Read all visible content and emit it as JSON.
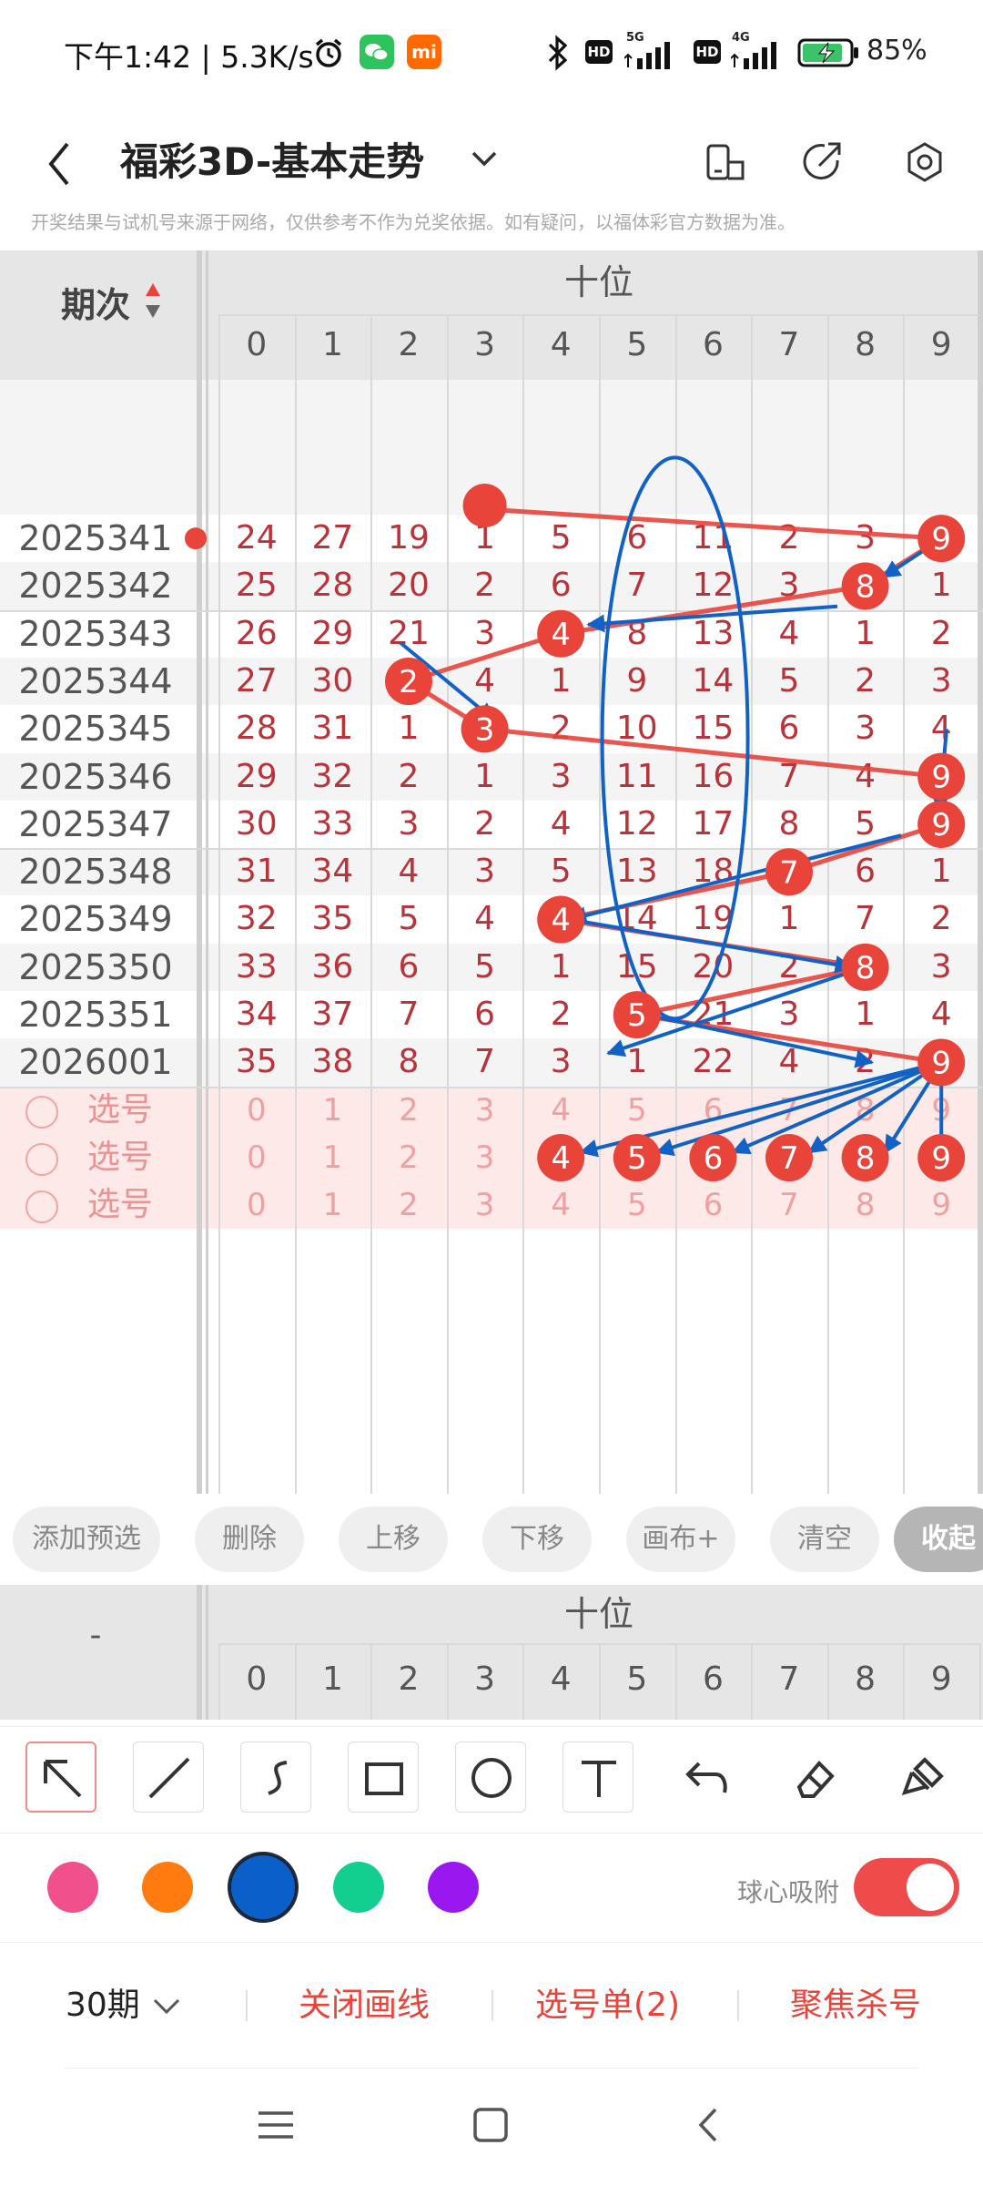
{
  "status": {
    "time": "下午1:42 | 5.3K/s",
    "icons": [
      "alarm-icon",
      "wechat-icon",
      "mi-icon"
    ],
    "right_icons": [
      "bluetooth-icon",
      "hd-signal-icon",
      "5g-signal-icon",
      "hd-signal-icon",
      "4g-signal-icon",
      "battery-icon"
    ],
    "net5g": "5G",
    "net4g": "4G",
    "hd": "HD",
    "mi": "mi",
    "battery": "85%",
    "battery_level": 0.85
  },
  "header": {
    "title": "福彩3D-基本走势",
    "icons": [
      "back-icon",
      "chevron-down-icon",
      "layout-icon",
      "share-icon",
      "settings-icon"
    ]
  },
  "notice": "开奖结果与试机号来源于网络，仅供参考不作为兑奖依据。如有疑问，以福体彩官方数据为准。",
  "grid": {
    "period_header": "期次",
    "section_header": "十位",
    "digit_headers": [
      "0",
      "1",
      "2",
      "3",
      "4",
      "5",
      "6",
      "7",
      "8",
      "9"
    ],
    "rows": [
      {
        "period": "2025341",
        "cells": [
          "24",
          "27",
          "19",
          "1",
          "5",
          "6",
          "11",
          "2",
          "3",
          "9"
        ],
        "hit": 9
      },
      {
        "period": "2025342",
        "cells": [
          "25",
          "28",
          "20",
          "2",
          "6",
          "7",
          "12",
          "3",
          "8",
          "1"
        ],
        "hit": 8
      },
      {
        "period": "2025343",
        "cells": [
          "26",
          "29",
          "21",
          "3",
          "4",
          "8",
          "13",
          "4",
          "1",
          "2"
        ],
        "hit": 4
      },
      {
        "period": "2025344",
        "cells": [
          "27",
          "30",
          "2",
          "4",
          "1",
          "9",
          "14",
          "5",
          "2",
          "3"
        ],
        "hit": 2
      },
      {
        "period": "2025345",
        "cells": [
          "28",
          "31",
          "1",
          "3",
          "2",
          "10",
          "15",
          "6",
          "3",
          "4"
        ],
        "hit": 3
      },
      {
        "period": "2025346",
        "cells": [
          "29",
          "32",
          "2",
          "1",
          "3",
          "11",
          "16",
          "7",
          "4",
          "9"
        ],
        "hit": 9
      },
      {
        "period": "2025347",
        "cells": [
          "30",
          "33",
          "3",
          "2",
          "4",
          "12",
          "17",
          "8",
          "5",
          "9"
        ],
        "hit": 9
      },
      {
        "period": "2025348",
        "cells": [
          "31",
          "34",
          "4",
          "3",
          "5",
          "13",
          "18",
          "7",
          "6",
          "1"
        ],
        "hit": 7
      },
      {
        "period": "2025349",
        "cells": [
          "32",
          "35",
          "5",
          "4",
          "4",
          "14",
          "19",
          "1",
          "7",
          "2"
        ],
        "hit": 4
      },
      {
        "period": "2025350",
        "cells": [
          "33",
          "36",
          "6",
          "5",
          "1",
          "15",
          "20",
          "2",
          "8",
          "3"
        ],
        "hit": 8
      },
      {
        "period": "2025351",
        "cells": [
          "34",
          "37",
          "7",
          "6",
          "2",
          "5",
          "21",
          "3",
          "1",
          "4"
        ],
        "hit": 5
      },
      {
        "period": "2026001",
        "cells": [
          "35",
          "38",
          "8",
          "7",
          "3",
          "1",
          "22",
          "4",
          "2",
          "9"
        ],
        "hit": 9
      }
    ],
    "pick_label": "选号",
    "pick_rows": [
      {
        "label": "选号",
        "cells": [
          "0",
          "1",
          "2",
          "3",
          "4",
          "5",
          "6",
          "7",
          "8",
          "9"
        ],
        "selected": []
      },
      {
        "label": "选号",
        "cells": [
          "0",
          "1",
          "2",
          "3",
          "4",
          "5",
          "6",
          "7",
          "8",
          "9"
        ],
        "selected": [
          4,
          5,
          6,
          7,
          8,
          9
        ]
      },
      {
        "label": "选号",
        "cells": [
          "0",
          "1",
          "2",
          "3",
          "4",
          "5",
          "6",
          "7",
          "8",
          "9"
        ],
        "selected": []
      }
    ]
  },
  "actions": [
    "添加预选",
    "删除",
    "上移",
    "下移",
    "画布+",
    "清空",
    "收起"
  ],
  "header2": {
    "period_header": "-",
    "section_header": "十位",
    "digit_headers": [
      "0",
      "1",
      "2",
      "3",
      "4",
      "5",
      "6",
      "7",
      "8",
      "9"
    ]
  },
  "tools": [
    "arrow-tool-icon",
    "line-tool-icon",
    "curve-tool-icon",
    "rectangle-tool-icon",
    "circle-tool-icon",
    "text-tool-icon",
    "undo-icon",
    "eraser-icon",
    "clear-brush-icon"
  ],
  "colors": {
    "swatches": [
      "#f0508c",
      "#ff7a0f",
      "#0a5fc8",
      "#13cf8f",
      "#9b17f0"
    ],
    "selected": "#0a5fc8",
    "red": "#e8443a",
    "blue": "#1262c6"
  },
  "snap_label": "球心吸附",
  "snap_on": true,
  "bottom": {
    "periods": "30期",
    "close_lines": "关闭画线",
    "pick_list": "选号单(2)",
    "focus_kill": "聚焦杀号"
  },
  "nav_icons": [
    "menu-icon",
    "home-icon",
    "back-nav-icon"
  ]
}
